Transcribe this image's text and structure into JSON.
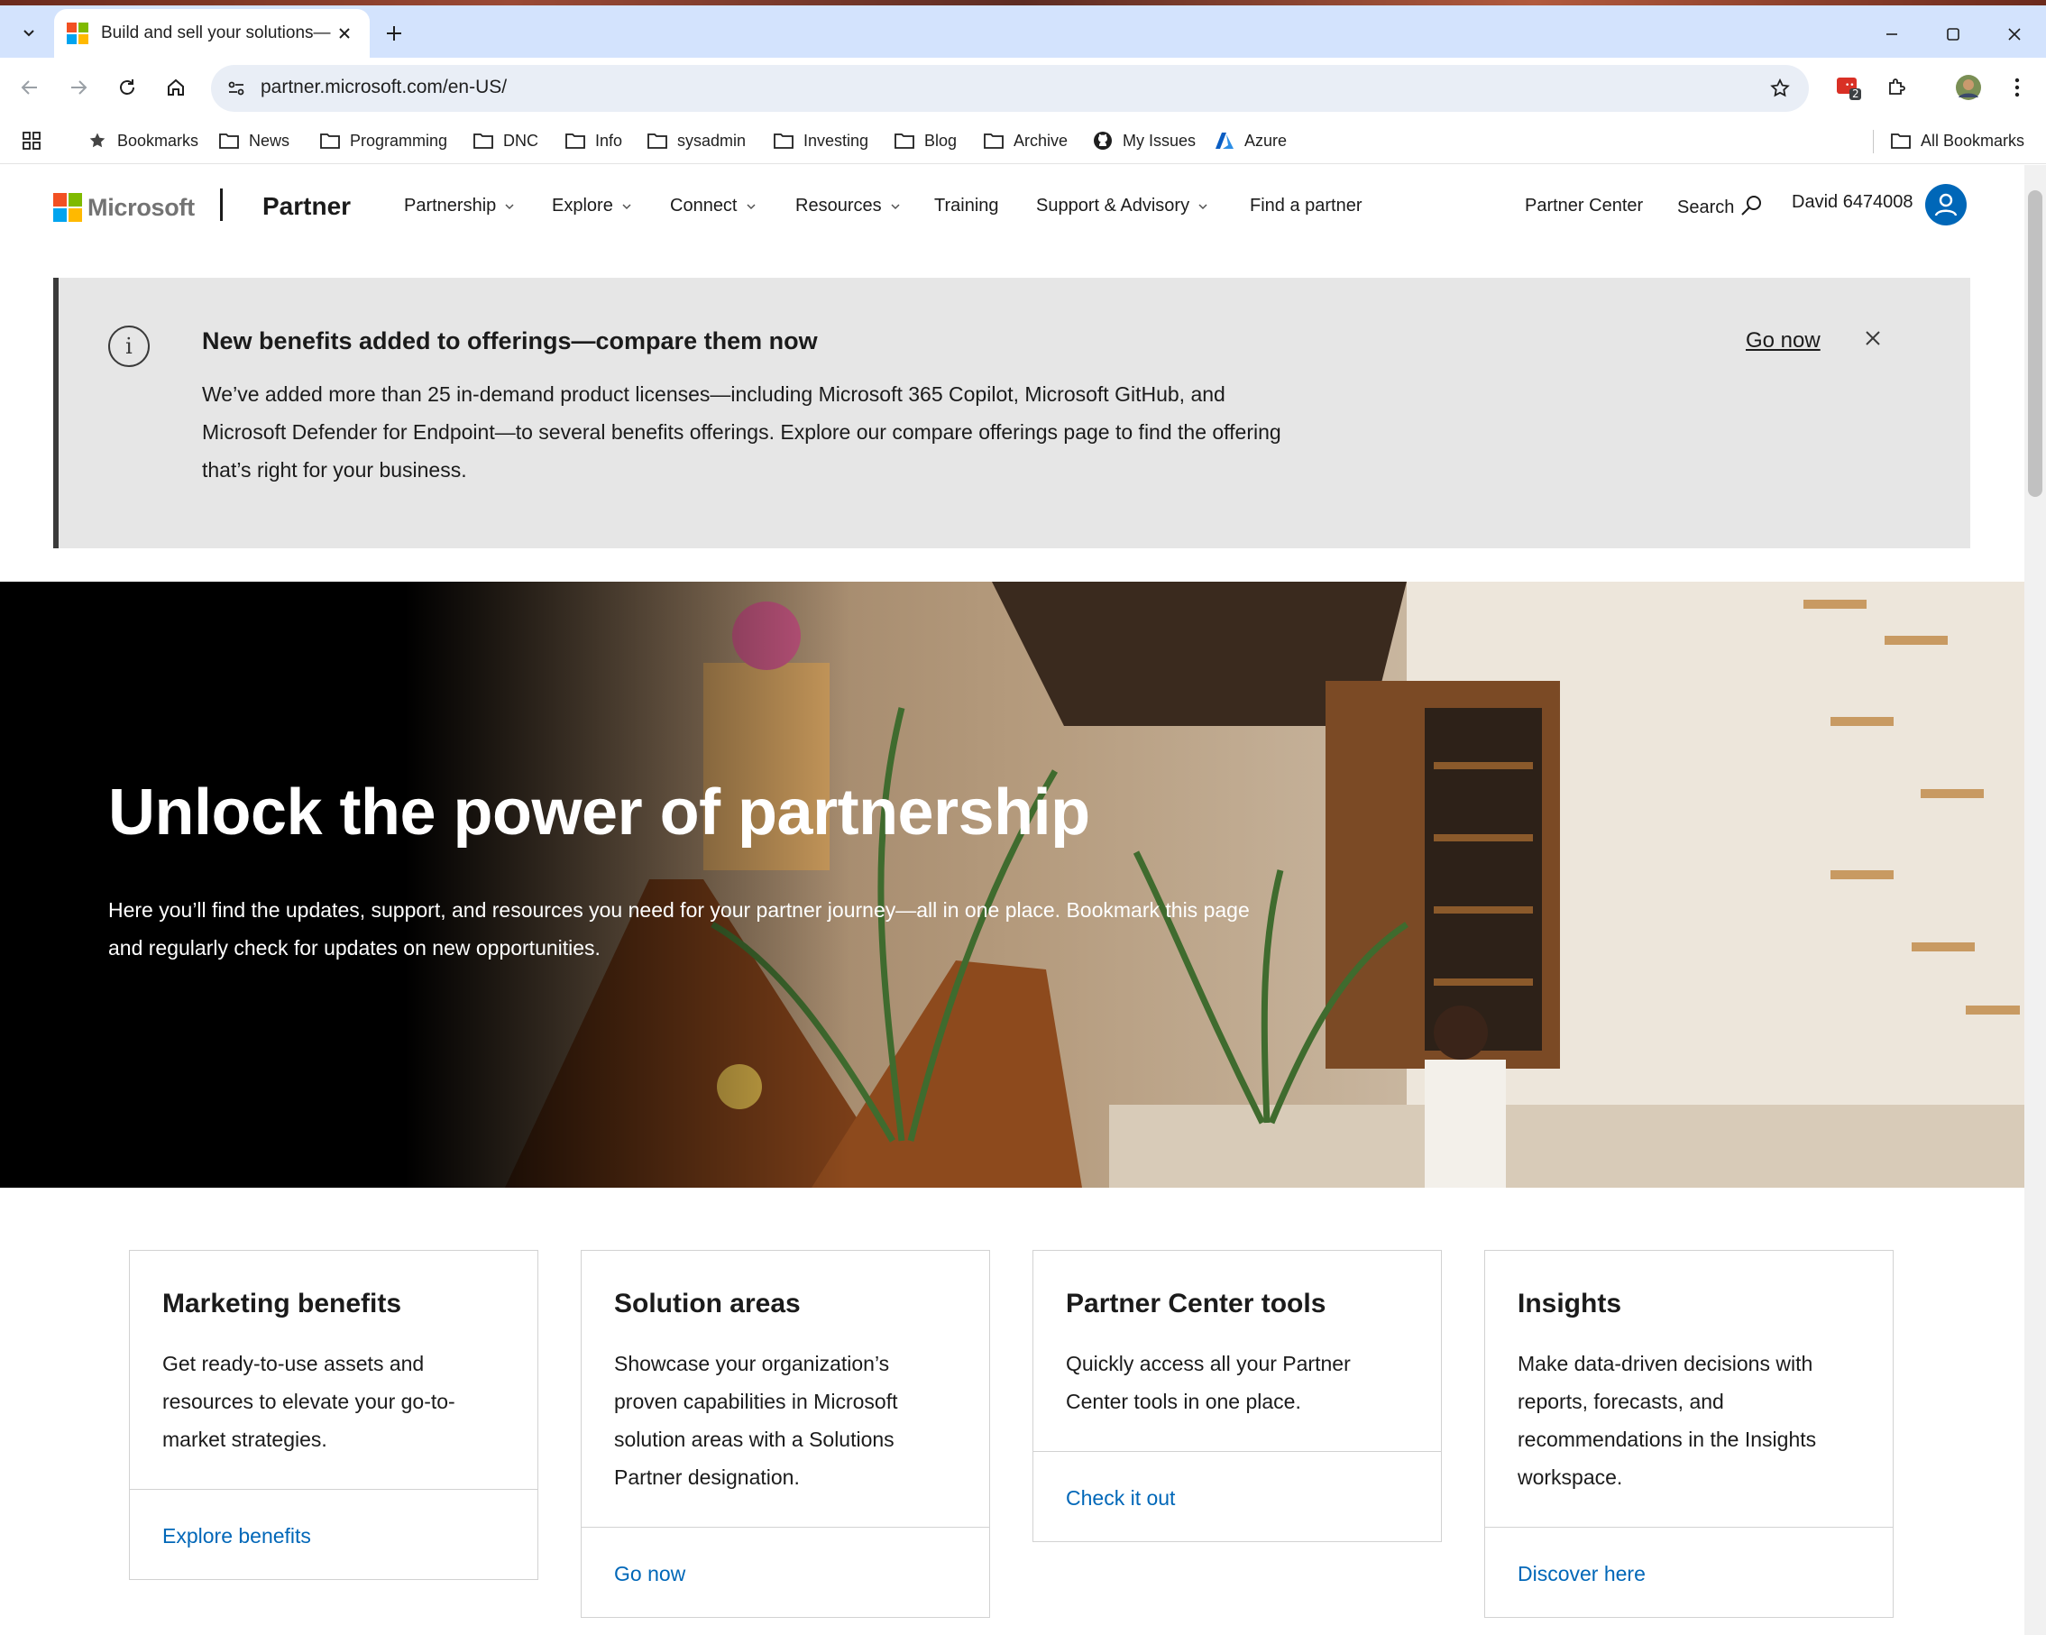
{
  "browser": {
    "tab_title": "Build and sell your solutions—",
    "url": "partner.microsoft.com/en-US/",
    "extension_badge": "2",
    "bookmarks": [
      {
        "label": "Bookmarks",
        "icon": "star-icon"
      },
      {
        "label": "News",
        "icon": "folder-icon"
      },
      {
        "label": "Programming",
        "icon": "folder-icon"
      },
      {
        "label": "DNC",
        "icon": "folder-icon"
      },
      {
        "label": "Info",
        "icon": "folder-icon"
      },
      {
        "label": "sysadmin",
        "icon": "folder-icon"
      },
      {
        "label": "Investing",
        "icon": "folder-icon"
      },
      {
        "label": "Blog",
        "icon": "folder-icon"
      },
      {
        "label": "Archive",
        "icon": "folder-icon"
      },
      {
        "label": "My Issues",
        "icon": "github-icon"
      },
      {
        "label": "Azure",
        "icon": "azure-icon"
      }
    ],
    "all_bookmarks": "All Bookmarks"
  },
  "header": {
    "brand": "Microsoft",
    "site": "Partner",
    "nav": [
      "Partnership",
      "Explore",
      "Connect",
      "Resources",
      "Training",
      "Support & Advisory",
      "Find a partner"
    ],
    "partner_center": "Partner Center",
    "search": "Search",
    "user": "David 6474008"
  },
  "banner": {
    "title": "New benefits added to offerings—compare them now",
    "text": "We’ve added more than 25 in-demand product licenses—including Microsoft 365 Copilot, Microsoft GitHub, and Microsoft Defender for Endpoint—to several benefits offerings. Explore our compare offerings page to find the offering that’s right for your business.",
    "link": "Go now"
  },
  "hero": {
    "title": "Unlock the power of partnership",
    "text": "Here you’ll find the updates, support, and resources you need for your partner journey—all in one place. Bookmark this page and regularly check for updates on new opportunities."
  },
  "cards": [
    {
      "title": "Marketing benefits",
      "text": "Get ready-to-use assets and resources to elevate your go-to-market strategies.",
      "link": "Explore benefits"
    },
    {
      "title": "Solution areas",
      "text": "Showcase your organization’s proven capabilities in Microsoft solution areas with a Solutions Partner designation.",
      "link": "Go now"
    },
    {
      "title": "Partner Center tools",
      "text": "Quickly access all your Partner Center tools in one place.",
      "link": "Check it out"
    },
    {
      "title": "Insights",
      "text": "Make data-driven decisions with reports, forecasts, and recommendations in the Insights workspace.",
      "link": "Discover here"
    }
  ],
  "colors": {
    "link_blue": "#0067b8",
    "ms_red": "#f25022",
    "ms_green": "#7fba00",
    "ms_blue": "#00a4ef",
    "ms_yellow": "#ffb900",
    "tab_strip": "#d3e3fd",
    "banner_bg": "#e6e6e6"
  }
}
